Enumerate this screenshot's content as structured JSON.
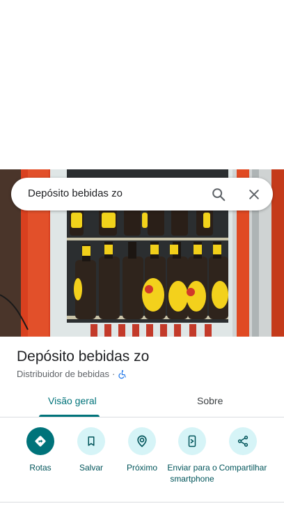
{
  "search": {
    "query": "Depósito bebidas zo"
  },
  "place": {
    "name": "Depósito bebidas zo",
    "category": "Distribuidor de bebidas",
    "separator": "·",
    "accessibility_icon": "wheelchair-icon"
  },
  "tabs": [
    {
      "label": "Visão geral",
      "active": true
    },
    {
      "label": "Sobre",
      "active": false
    }
  ],
  "actions": [
    {
      "label": "Rotas",
      "icon": "directions-icon"
    },
    {
      "label": "Salvar",
      "icon": "bookmark-icon"
    },
    {
      "label": "Próximo",
      "icon": "nearby-icon"
    },
    {
      "label": "Enviar para o smartphone",
      "icon": "send-to-phone-icon"
    },
    {
      "label": "Compartilhar",
      "icon": "share-icon"
    }
  ],
  "colors": {
    "accent": "#00737a",
    "action_bg": "#d6f4f7",
    "action_label": "#00545a"
  }
}
